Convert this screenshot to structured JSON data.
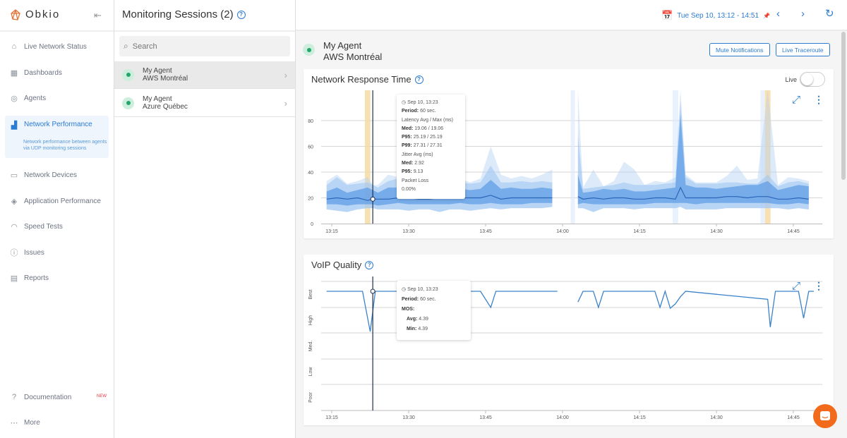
{
  "app": {
    "name": "Obkio"
  },
  "sidebar": {
    "items": [
      {
        "label": "Live Network Status",
        "icon": "home-icon"
      },
      {
        "label": "Dashboards",
        "icon": "dashboard-icon"
      },
      {
        "label": "Agents",
        "icon": "agents-icon"
      },
      {
        "label": "Network Performance",
        "icon": "bar-chart-icon",
        "description": "Network performance between agents via UDP monitoring sessions"
      },
      {
        "label": "Network Devices",
        "icon": "router-icon"
      },
      {
        "label": "Application Performance",
        "icon": "layers-icon"
      },
      {
        "label": "Speed Tests",
        "icon": "gauge-icon"
      },
      {
        "label": "Issues",
        "icon": "alert-icon"
      },
      {
        "label": "Reports",
        "icon": "report-icon"
      }
    ],
    "documentation": "Documentation",
    "new_badge": "NEW",
    "more": "More"
  },
  "sessions": {
    "title": "Monitoring Sessions (2)",
    "search_placeholder": "Search",
    "items": [
      {
        "agent": "My Agent",
        "target": "AWS Montréal",
        "selected": true
      },
      {
        "agent": "My Agent",
        "target": "Azure Québec",
        "selected": false
      }
    ]
  },
  "header": {
    "date_range": "Tue Sep 10, 13:12 - 14:51"
  },
  "agent": {
    "name": "My Agent",
    "target": "AWS Montréal",
    "mute_label": "Mute Notifications",
    "traceroute_label": "Live Traceroute"
  },
  "colors": {
    "accent": "#2b7bd1",
    "status_ok": "#22a86a",
    "incident": "#f5d9a0",
    "chat": "#f26b1d"
  },
  "response_chart": {
    "title": "Network Response Time",
    "live_label": "Live",
    "live_on": false,
    "tooltip": {
      "time": "Sep 10, 13:23",
      "period_label": "Period:",
      "period": "60 sec.",
      "latency_title": "Latency Avg / Max (ms)",
      "med_label": "Med:",
      "med": "19.06 / 19.06",
      "p95_label": "P95:",
      "p95": "25.19 / 25.19",
      "p99_label": "P99:",
      "p99": "27.31 / 27.31",
      "jitter_title": "Jitter Avg (ms)",
      "jmed_label": "Med:",
      "jmed": "2.92",
      "jp95_label": "P95:",
      "jp95": "9.13",
      "loss_title": "Packet Loss",
      "loss": "0.00%"
    }
  },
  "voip_chart": {
    "title": "VoIP Quality",
    "tooltip": {
      "time": "Sep 10, 13:23",
      "period_label": "Period:",
      "period": "60 sec.",
      "mos_label": "MOS:",
      "avg_label": "Avg:",
      "avg": "4.39",
      "min_label": "Min:",
      "min": "4.39"
    }
  },
  "chart_data": [
    {
      "type": "area",
      "title": "Network Response Time",
      "ylim": [
        0,
        100
      ],
      "yticks": [
        0,
        20,
        40,
        60,
        80
      ],
      "xticks": [
        "13:15",
        "13:30",
        "13:45",
        "14:00",
        "14:15",
        "14:30",
        "14:45"
      ],
      "cursor": "13:23",
      "incidents": [
        "13:22",
        "14:40"
      ],
      "segments": [
        {
          "x": [
            "13:14",
            "13:16",
            "13:18",
            "13:20",
            "13:22",
            "13:23",
            "13:24",
            "13:26",
            "13:28",
            "13:30",
            "13:32",
            "13:34",
            "13:36",
            "13:38",
            "13:40",
            "13:42",
            "13:44",
            "13:46",
            "13:48",
            "13:50",
            "13:52",
            "13:54",
            "13:56",
            "13:58"
          ],
          "median": [
            19,
            20,
            19,
            20,
            18,
            19,
            19,
            19,
            20,
            20,
            19,
            19,
            20,
            20,
            20,
            20,
            20,
            22,
            19,
            20,
            20,
            20,
            20,
            20
          ],
          "inner_lo": [
            15,
            15,
            14,
            15,
            15,
            15,
            14,
            15,
            16,
            15,
            15,
            15,
            15,
            15,
            16,
            15,
            15,
            16,
            15,
            15,
            15,
            16,
            16,
            16
          ],
          "inner_hi": [
            25,
            28,
            24,
            26,
            28,
            26,
            24,
            28,
            28,
            27,
            27,
            27,
            26,
            27,
            27,
            26,
            27,
            34,
            27,
            28,
            27,
            27,
            28,
            27
          ],
          "outer_lo": [
            11,
            10,
            9,
            11,
            12,
            12,
            11,
            11,
            11,
            10,
            11,
            11,
            9,
            11,
            11,
            10,
            11,
            12,
            11,
            12,
            12,
            12,
            12,
            13
          ],
          "outer_hi": [
            30,
            36,
            30,
            31,
            32,
            30,
            28,
            33,
            35,
            32,
            33,
            32,
            30,
            33,
            32,
            31,
            32,
            45,
            32,
            32,
            33,
            32,
            33,
            32
          ],
          "max": [
            33,
            38,
            31,
            33,
            36,
            30,
            30,
            38,
            36,
            34,
            35,
            34,
            33,
            34,
            35,
            32,
            35,
            60,
            38,
            35,
            37,
            35,
            38,
            42
          ]
        },
        {
          "x": [
            "14:03",
            "14:04",
            "14:06",
            "14:08",
            "14:10",
            "14:12",
            "14:14",
            "14:16",
            "14:18",
            "14:20",
            "14:22",
            "14:23",
            "14:24",
            "14:26",
            "14:28",
            "14:30",
            "14:32",
            "14:34",
            "14:36",
            "14:38",
            "14:40",
            "14:42",
            "14:44",
            "14:46",
            "14:48"
          ],
          "median": [
            21,
            19,
            20,
            19,
            20,
            20,
            19,
            19,
            20,
            20,
            19,
            28,
            20,
            20,
            20,
            20,
            21,
            21,
            20,
            21,
            21,
            19,
            19,
            20,
            19
          ],
          "inner_lo": [
            15,
            16,
            15,
            15,
            15,
            15,
            15,
            15,
            16,
            16,
            16,
            16,
            16,
            15,
            16,
            16,
            16,
            16,
            16,
            16,
            16,
            15,
            15,
            16,
            15
          ],
          "inner_hi": [
            38,
            24,
            25,
            27,
            26,
            27,
            25,
            25,
            26,
            27,
            28,
            85,
            30,
            28,
            28,
            27,
            28,
            29,
            30,
            30,
            33,
            26,
            28,
            30,
            29
          ],
          "outer_lo": [
            12,
            12,
            9,
            12,
            12,
            12,
            11,
            12,
            12,
            12,
            12,
            13,
            11,
            11,
            11,
            11,
            12,
            12,
            12,
            12,
            12,
            12,
            11,
            12,
            11
          ],
          "outer_hi": [
            70,
            27,
            28,
            29,
            30,
            32,
            30,
            30,
            30,
            31,
            32,
            95,
            36,
            31,
            31,
            31,
            32,
            32,
            31,
            31,
            38,
            29,
            32,
            33,
            31
          ],
          "max": [
            110,
            28,
            42,
            29,
            33,
            48,
            42,
            30,
            33,
            32,
            36,
            110,
            38,
            32,
            32,
            32,
            37,
            45,
            34,
            35,
            110,
            30,
            36,
            35,
            33
          ]
        }
      ]
    },
    {
      "type": "line",
      "title": "VoIP Quality",
      "ylabels": [
        "Best",
        "High",
        "Med.",
        "Low",
        "Poor"
      ],
      "xticks": [
        "13:15",
        "13:30",
        "13:45",
        "14:00",
        "14:15",
        "14:30",
        "14:45"
      ],
      "cursor": "13:23",
      "segments": [
        {
          "x": [
            "13:14",
            "13:21",
            "13:22.5",
            "13:23.5",
            "13:44",
            "13:46",
            "13:47",
            "13:59"
          ],
          "mos": [
            4.39,
            4.39,
            3.94,
            4.39,
            4.39,
            4.21,
            4.39,
            4.39
          ]
        },
        {
          "x": [
            "14:03",
            "14:04",
            "14:06",
            "14:07",
            "14:08",
            "14:18",
            "14:19",
            "14:20",
            "14:21",
            "14:22",
            "14:23",
            "14:24",
            "14:40",
            "14:40.5",
            "14:41.5",
            "14:44",
            "14:46",
            "14:47",
            "14:48",
            "14:49"
          ],
          "mos": [
            4.27,
            4.39,
            4.39,
            4.21,
            4.39,
            4.39,
            4.21,
            4.39,
            4.2,
            4.25,
            4.33,
            4.39,
            4.3,
            3.99,
            4.39,
            4.39,
            4.39,
            4.09,
            4.39,
            4.39
          ]
        }
      ]
    }
  ]
}
